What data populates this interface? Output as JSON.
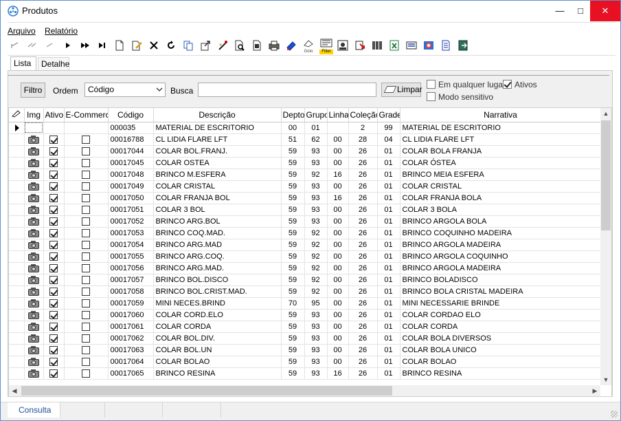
{
  "window": {
    "title": "Produtos",
    "controls": {
      "minimize": "—",
      "maximize": "□",
      "close": "✕"
    }
  },
  "menu": [
    "Arquivo",
    "Relatório"
  ],
  "toolbar": {
    "icons": [
      "first-icon",
      "prev-page-icon",
      "prev-icon",
      "next-icon",
      "next-page-icon",
      "last-icon",
      "new-icon",
      "edit-icon",
      "delete-icon",
      "refresh-icon",
      "copy-icon",
      "export-icon",
      "tools-icon",
      "preview-icon",
      "document-icon",
      "print-icon",
      "bookmark-icon",
      "goto-icon",
      "filter-icon",
      "image-icon",
      "import-icon",
      "barcode-icon",
      "excel-icon",
      "report-icon",
      "color-icon",
      "notes-icon",
      "exit-icon"
    ],
    "goto_label": "Goto",
    "filter_label": "Filter"
  },
  "tabs": [
    "Lista",
    "Detalhe"
  ],
  "filters": {
    "filtro_label": "Filtro",
    "ordem_label": "Ordem",
    "ordem_value": "Código",
    "busca_label": "Busca",
    "busca_value": "",
    "limpar_label": "Limpar",
    "qualquer_lugar_label": "Em qualquer lugar",
    "qualquer_lugar": false,
    "ativos_label": "Ativos",
    "ativos": true,
    "modo_sensitivo_label": "Modo sensitivo",
    "modo_sensitivo": false
  },
  "grid": {
    "columns": [
      "Img",
      "Ativo",
      "E-Commerce",
      "Código",
      "Descrição",
      "Depto",
      "Grupo",
      "Linha",
      "Coleção",
      "Grade",
      "Narrativa"
    ],
    "rows": [
      {
        "img": false,
        "ativo": false,
        "ecom": false,
        "codigo": "000035",
        "descricao": "MATERIAL DE ESCRITORIO",
        "depto": "00",
        "grupo": "01",
        "linha": "",
        "colecao": "2",
        "grade": "99",
        "narrativa": "MATERIAL DE ESCRITORIO"
      },
      {
        "img": true,
        "ativo": true,
        "ecom": false,
        "codigo": "00016788",
        "descricao": "CL LIDIA FLARE LFT",
        "depto": "51",
        "grupo": "62",
        "linha": "00",
        "colecao": "28",
        "grade": "04",
        "narrativa": "CL LIDIA FLARE LFT"
      },
      {
        "img": true,
        "ativo": true,
        "ecom": false,
        "codigo": "00017044",
        "descricao": "COLAR BOL.FRANJ.",
        "depto": "59",
        "grupo": "93",
        "linha": "00",
        "colecao": "26",
        "grade": "01",
        "narrativa": "COLAR BOLA FRANJA"
      },
      {
        "img": true,
        "ativo": true,
        "ecom": false,
        "codigo": "00017045",
        "descricao": "COLAR OSTEA",
        "depto": "59",
        "grupo": "93",
        "linha": "00",
        "colecao": "26",
        "grade": "01",
        "narrativa": "COLAR ÓSTEA"
      },
      {
        "img": true,
        "ativo": true,
        "ecom": false,
        "codigo": "00017048",
        "descricao": "BRINCO M.ESFERA",
        "depto": "59",
        "grupo": "92",
        "linha": "16",
        "colecao": "26",
        "grade": "01",
        "narrativa": "BRINCO MEIA ESFERA"
      },
      {
        "img": true,
        "ativo": true,
        "ecom": false,
        "codigo": "00017049",
        "descricao": "COLAR CRISTAL",
        "depto": "59",
        "grupo": "93",
        "linha": "00",
        "colecao": "26",
        "grade": "01",
        "narrativa": "COLAR CRISTAL"
      },
      {
        "img": true,
        "ativo": true,
        "ecom": false,
        "codigo": "00017050",
        "descricao": "COLAR FRANJA BOL",
        "depto": "59",
        "grupo": "93",
        "linha": "16",
        "colecao": "26",
        "grade": "01",
        "narrativa": "COLAR FRANJA BOLA"
      },
      {
        "img": true,
        "ativo": true,
        "ecom": false,
        "codigo": "00017051",
        "descricao": "COLAR 3 BOL",
        "depto": "59",
        "grupo": "93",
        "linha": "00",
        "colecao": "26",
        "grade": "01",
        "narrativa": "COLAR 3 BOLA"
      },
      {
        "img": true,
        "ativo": true,
        "ecom": false,
        "codigo": "00017052",
        "descricao": "BRINCO ARG.BOL",
        "depto": "59",
        "grupo": "93",
        "linha": "00",
        "colecao": "26",
        "grade": "01",
        "narrativa": "BRINCO ARGOLA BOLA"
      },
      {
        "img": true,
        "ativo": true,
        "ecom": false,
        "codigo": "00017053",
        "descricao": "BRINCO COQ.MAD.",
        "depto": "59",
        "grupo": "92",
        "linha": "00",
        "colecao": "26",
        "grade": "01",
        "narrativa": "BRINCO COQUINHO MADEIRA"
      },
      {
        "img": true,
        "ativo": true,
        "ecom": false,
        "codigo": "00017054",
        "descricao": "BRINCO ARG.MAD",
        "depto": "59",
        "grupo": "92",
        "linha": "00",
        "colecao": "26",
        "grade": "01",
        "narrativa": "BRINCO ARGOLA MADEIRA"
      },
      {
        "img": true,
        "ativo": true,
        "ecom": false,
        "codigo": "00017055",
        "descricao": "BRINCO ARG.COQ.",
        "depto": "59",
        "grupo": "92",
        "linha": "00",
        "colecao": "26",
        "grade": "01",
        "narrativa": "BRINCO ARGOLA COQUINHO"
      },
      {
        "img": true,
        "ativo": true,
        "ecom": false,
        "codigo": "00017056",
        "descricao": "BRINCO ARG.MAD.",
        "depto": "59",
        "grupo": "92",
        "linha": "00",
        "colecao": "26",
        "grade": "01",
        "narrativa": "BRINCO ARGOLA MADEIRA"
      },
      {
        "img": true,
        "ativo": true,
        "ecom": false,
        "codigo": "00017057",
        "descricao": "BRINCO BOL.DISCO",
        "depto": "59",
        "grupo": "92",
        "linha": "00",
        "colecao": "26",
        "grade": "01",
        "narrativa": "BRINCO BOLADISCO"
      },
      {
        "img": true,
        "ativo": true,
        "ecom": false,
        "codigo": "00017058",
        "descricao": "BRINCO BOL.CRIST.MAD.",
        "depto": "59",
        "grupo": "92",
        "linha": "00",
        "colecao": "26",
        "grade": "01",
        "narrativa": "BRINCO BOLA CRISTAL MADEIRA"
      },
      {
        "img": true,
        "ativo": true,
        "ecom": false,
        "codigo": "00017059",
        "descricao": "MINI NECES.BRIND",
        "depto": "70",
        "grupo": "95",
        "linha": "00",
        "colecao": "26",
        "grade": "01",
        "narrativa": "MINI NECESSARIE BRINDE"
      },
      {
        "img": true,
        "ativo": true,
        "ecom": false,
        "codigo": "00017060",
        "descricao": "COLAR CORD.ELO",
        "depto": "59",
        "grupo": "93",
        "linha": "00",
        "colecao": "26",
        "grade": "01",
        "narrativa": "COLAR CORDAO ELO"
      },
      {
        "img": true,
        "ativo": true,
        "ecom": false,
        "codigo": "00017061",
        "descricao": "COLAR CORDA",
        "depto": "59",
        "grupo": "93",
        "linha": "00",
        "colecao": "26",
        "grade": "01",
        "narrativa": "COLAR CORDA"
      },
      {
        "img": true,
        "ativo": true,
        "ecom": false,
        "codigo": "00017062",
        "descricao": "COLAR BOL.DIV.",
        "depto": "59",
        "grupo": "93",
        "linha": "00",
        "colecao": "26",
        "grade": "01",
        "narrativa": "COLAR BOLA DIVERSOS"
      },
      {
        "img": true,
        "ativo": true,
        "ecom": false,
        "codigo": "00017063",
        "descricao": "COLAR BOL.UN",
        "depto": "59",
        "grupo": "93",
        "linha": "00",
        "colecao": "26",
        "grade": "01",
        "narrativa": "COLAR BOLA UNICO"
      },
      {
        "img": true,
        "ativo": true,
        "ecom": false,
        "codigo": "00017064",
        "descricao": "COLAR BOLAO",
        "depto": "59",
        "grupo": "93",
        "linha": "00",
        "colecao": "26",
        "grade": "01",
        "narrativa": "COLAR BOLAO"
      },
      {
        "img": true,
        "ativo": true,
        "ecom": false,
        "codigo": "00017065",
        "descricao": "BRINCO RESINA",
        "depto": "59",
        "grupo": "93",
        "linha": "16",
        "colecao": "26",
        "grade": "01",
        "narrativa": "BRINCO RESINA"
      }
    ]
  },
  "status": {
    "mode": "Consulta"
  }
}
